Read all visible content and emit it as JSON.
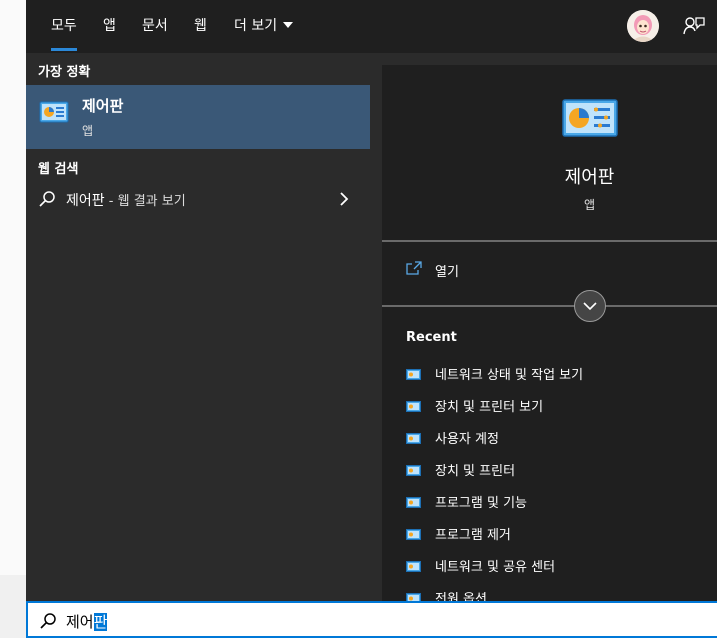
{
  "tabs": [
    {
      "label": "모두",
      "active": true
    },
    {
      "label": "앱"
    },
    {
      "label": "문서"
    },
    {
      "label": "웹"
    },
    {
      "label": "더 보기"
    }
  ],
  "header": {
    "avatar_icon": "user-avatar",
    "feedback_icon": "feedback-icon"
  },
  "left": {
    "best_match_heading": "가장 정확",
    "best_match": {
      "title": "제어판",
      "subtitle": "앱",
      "icon": "control-panel-icon"
    },
    "web_heading": "웹 검색",
    "web_result": {
      "query": "제어판",
      "suffix": " - 웹 결과 보기"
    }
  },
  "preview": {
    "title": "제어판",
    "subtitle": "앱",
    "open_label": "열기",
    "recent_heading": "Recent",
    "recent": [
      "네트워크 상태 및 작업 보기",
      "장치 및 프린터 보기",
      "사용자 계정",
      "장치 및 프린터",
      "프로그램 및 기능",
      "프로그램 제거",
      "네트워크 및 공유 센터",
      "전원 옵션"
    ]
  },
  "search": {
    "typed": "제어",
    "selected": "판"
  },
  "colors": {
    "accent": "#0078d7",
    "selected_row": "#3a5877",
    "panel": "#2b2b2b",
    "pane": "#1f1f1f"
  }
}
